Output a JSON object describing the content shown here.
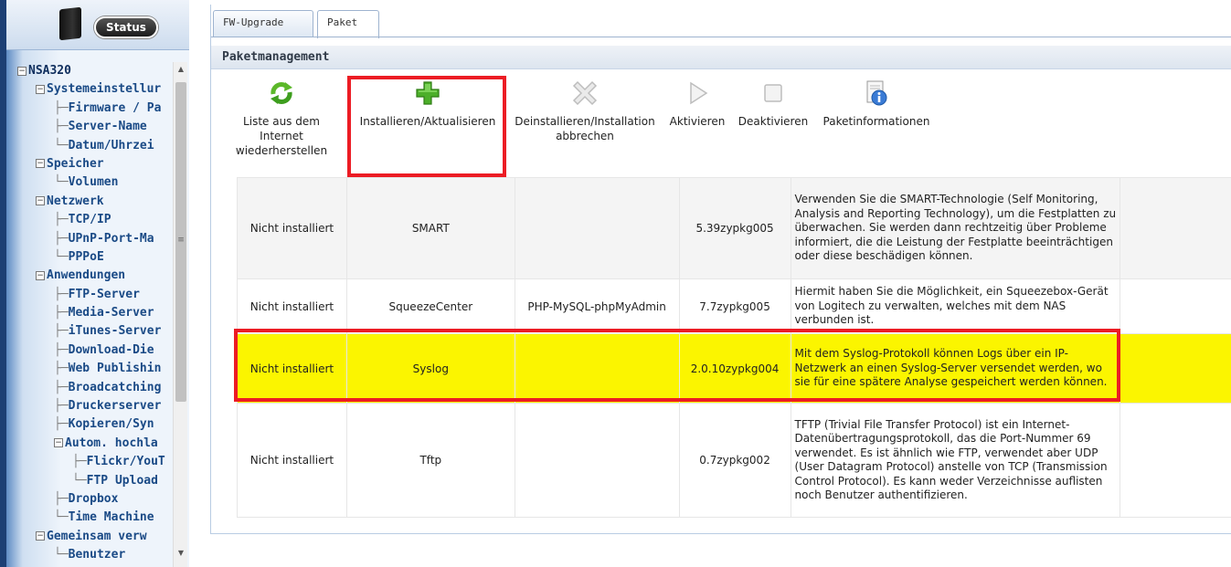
{
  "sidebar": {
    "status_button": "Status",
    "tree": [
      {
        "label": "NSA320",
        "level": 0,
        "exp": "-"
      },
      {
        "label": "Systemeinstellur",
        "level": 1,
        "exp": "-"
      },
      {
        "label": "Firmware / Pa",
        "level": 2
      },
      {
        "label": "Server-Name",
        "level": 2
      },
      {
        "label": "Datum/Uhrzei",
        "level": 2,
        "last": true
      },
      {
        "label": "Speicher",
        "level": 1,
        "exp": "-"
      },
      {
        "label": "Volumen",
        "level": 2,
        "last": true
      },
      {
        "label": "Netzwerk",
        "level": 1,
        "exp": "-"
      },
      {
        "label": "TCP/IP",
        "level": 2
      },
      {
        "label": "UPnP-Port-Ma",
        "level": 2
      },
      {
        "label": "PPPoE",
        "level": 2,
        "last": true
      },
      {
        "label": "Anwendungen",
        "level": 1,
        "exp": "-"
      },
      {
        "label": "FTP-Server",
        "level": 2
      },
      {
        "label": "Media-Server",
        "level": 2
      },
      {
        "label": "iTunes-Server",
        "level": 2
      },
      {
        "label": "Download-Die",
        "level": 2
      },
      {
        "label": "Web Publishin",
        "level": 2
      },
      {
        "label": "Broadcatching",
        "level": 2
      },
      {
        "label": "Druckerserver",
        "level": 2
      },
      {
        "label": "Kopieren/Syn",
        "level": 2
      },
      {
        "label": "Autom. hochla",
        "level": 2,
        "exp": "-"
      },
      {
        "label": "Flickr/YouT",
        "level": 3
      },
      {
        "label": "FTP Upload",
        "level": 3,
        "last": true
      },
      {
        "label": "Dropbox",
        "level": 2
      },
      {
        "label": "Time Machine",
        "level": 2,
        "last": true
      },
      {
        "label": "Gemeinsam verw",
        "level": 1,
        "exp": "-"
      },
      {
        "label": "Benutzer",
        "level": 2,
        "last": true
      }
    ]
  },
  "tabs": [
    {
      "label": "FW-Upgrade",
      "active": false
    },
    {
      "label": "Paket",
      "active": true
    }
  ],
  "section_title": "Paketmanagement",
  "toolbar": [
    {
      "id": "refresh",
      "icon": "refresh-icon",
      "label": "Liste aus dem Internet wiederherstellen"
    },
    {
      "id": "install",
      "icon": "plus-icon",
      "label": "Installieren/Aktualisieren"
    },
    {
      "id": "uninstall",
      "icon": "uninstall-icon",
      "label": "Deinstallieren/Installation abbrechen"
    },
    {
      "id": "enable",
      "icon": "play-icon",
      "label": "Aktivieren"
    },
    {
      "id": "disable",
      "icon": "stop-icon",
      "label": "Deaktivieren"
    },
    {
      "id": "info",
      "icon": "info-icon",
      "label": "Paketinformationen"
    }
  ],
  "packages": [
    {
      "status": "Nicht installiert",
      "name": "SMART",
      "requires": "",
      "version": "5.39zypkg005",
      "description": "Verwenden Sie die SMART-Technologie (Self Monitoring, Analysis and Reporting Technology), um die Festplatten zu überwachen. Sie werden dann rechtzeitig über Probleme informiert, die die Leistung der Festplatte beeinträchtigen oder diese beschädigen können.",
      "selected": false
    },
    {
      "status": "Nicht installiert",
      "name": "SqueezeCenter",
      "requires": "PHP-MySQL-phpMyAdmin",
      "version": "7.7zypkg005",
      "description": "Hiermit haben Sie die Möglichkeit, ein Squeezebox-Gerät von Logitech zu verwalten, welches mit dem NAS verbunden ist.",
      "selected": false
    },
    {
      "status": "Nicht installiert",
      "name": "Syslog",
      "requires": "",
      "version": "2.0.10zypkg004",
      "description": "Mit dem Syslog-Protokoll können Logs über ein IP-Netzwerk an einen Syslog-Server versendet werden, wo sie für eine spätere Analyse gespeichert werden können.",
      "selected": true
    },
    {
      "status": "Nicht installiert",
      "name": "Tftp",
      "requires": "",
      "version": "0.7zypkg002",
      "description": "TFTP (Trivial File Transfer Protocol) ist ein Internet-Datenübertragungsprotokoll, das die Port-Nummer 69 verwendet. Es ist ähnlich wie FTP, verwendet aber UDP (User Datagram Protocol) anstelle von TCP (Transmission Control Protocol). Es kann weder Verzeichnisse auflisten noch Benutzer authentifizieren.",
      "selected": false
    }
  ],
  "colors": {
    "highlight_border": "#ec1c24",
    "selected_row": "#fbf500",
    "tree_text": "#1a4a86"
  }
}
